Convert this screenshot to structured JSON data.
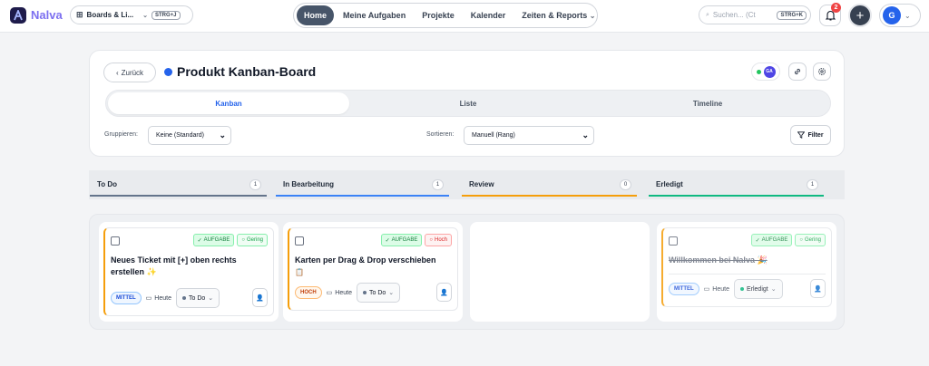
{
  "app": {
    "name": "Nalva"
  },
  "workspace": {
    "label": "Boards & Li...",
    "shortcut": "STRG+J"
  },
  "nav": {
    "items": [
      "Home",
      "Meine Aufgaben",
      "Projekte",
      "Kalender",
      "Zeiten & Reports"
    ],
    "active": "Home"
  },
  "search": {
    "placeholder": "Suchen... (Ct",
    "shortcut": "STRG+K"
  },
  "notifications": {
    "count": "2"
  },
  "user": {
    "initial": "G"
  },
  "header": {
    "back_label": "Zurück",
    "title": "Produkt Kanban-Board",
    "title_color": "#2563eb",
    "presence_initials": "GA",
    "views": [
      "Kanban",
      "Liste",
      "Timeline"
    ],
    "active_view": "Kanban",
    "group_label": "Gruppieren:",
    "group_value": "Keine (Standard)",
    "sort_label": "Sortieren:",
    "sort_value": "Manuell (Rang)",
    "filter_label": "Filter"
  },
  "columns": [
    {
      "title": "To Do",
      "count": "1",
      "accent": "#64748b"
    },
    {
      "title": "In Bearbeitung",
      "count": "1",
      "accent": "#3b82f6"
    },
    {
      "title": "Review",
      "count": "0",
      "accent": "#f59e0b"
    },
    {
      "title": "Erledigt",
      "count": "1",
      "accent": "#10b981"
    }
  ],
  "cards": [
    {
      "type_tag": "AUFGABE",
      "level_tag": "Gering",
      "title_line1": "Neues Ticket mit [+] oben rechts",
      "title_line2": "erstellen",
      "priority": "MITTEL",
      "date": "Heute",
      "status": "To Do"
    },
    {
      "type_tag": "AUFGABE",
      "level_tag": "Hoch",
      "title_line1": "Karten per Drag & Drop verschieben",
      "title_line2": "",
      "priority": "HOCH",
      "date": "Heute",
      "status": "To Do"
    },
    {
      "type_tag": "AUFGABE",
      "level_tag": "Gering",
      "title_line1": "Willkommen bei Nalva",
      "title_line2": "",
      "priority": "MITTEL",
      "date": "Heute",
      "status": "Erledigt"
    }
  ]
}
